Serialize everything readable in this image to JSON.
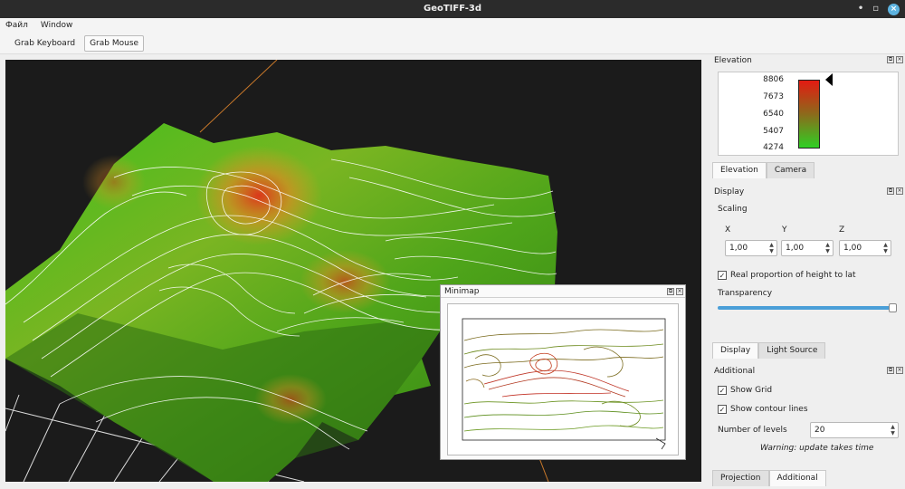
{
  "window": {
    "title": "GeoTIFF-3d",
    "minimize_glyph": "•",
    "restore_glyph": "▫",
    "close_glyph": "×"
  },
  "menu": {
    "items": [
      "Файл",
      "Window"
    ]
  },
  "toolbar": {
    "grab_keyboard": "Grab Keyboard",
    "grab_mouse": "Grab Mouse"
  },
  "elevation": {
    "title": "Elevation",
    "ticks": [
      "8806",
      "7673",
      "6540",
      "5407",
      "4274"
    ],
    "colors": {
      "high": "#e31b12",
      "low": "#2fd024"
    }
  },
  "tabs_top": [
    "Elevation",
    "Camera"
  ],
  "display": {
    "title": "Display",
    "scaling_label": "Scaling",
    "x_label": "X",
    "y_label": "Y",
    "z_label": "Z",
    "x_value": "1,00",
    "y_value": "1,00",
    "z_value": "1,00",
    "real_proportion_label": "Real proportion of height to lat",
    "real_proportion_checked": true,
    "transparency_label": "Transparency",
    "transparency_value": 1.0
  },
  "tabs_middle": [
    "Display",
    "Light Source"
  ],
  "additional": {
    "title": "Additional",
    "show_grid_label": "Show Grid",
    "show_grid_checked": true,
    "show_contour_label": "Show contour lines",
    "show_contour_checked": true,
    "levels_label": "Number of levels",
    "levels_value": "20",
    "warning": "Warning: update takes time"
  },
  "tabs_bottom": [
    "Projection",
    "Additional"
  ],
  "minimap": {
    "title": "Minimap"
  },
  "icons": {
    "check": "✓",
    "spin_up": "▲",
    "spin_down": "▼",
    "float": "⧉",
    "close": "×"
  }
}
